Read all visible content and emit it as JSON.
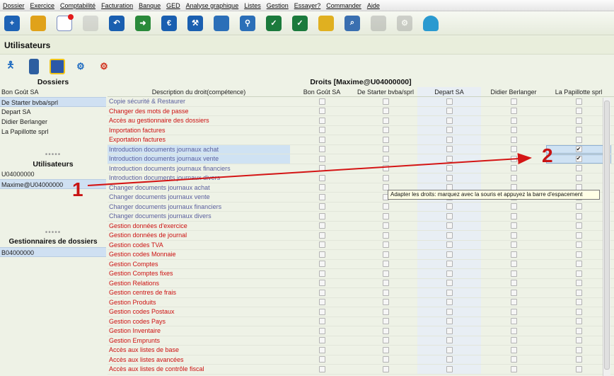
{
  "menu": [
    "Dossier",
    "Exercice",
    "Comptabilité",
    "Facturation",
    "Banque",
    "GED",
    "Analyse graphique",
    "Listes",
    "Gestion",
    "Essayer?",
    "Commander",
    "Aide"
  ],
  "toolbar_icons": [
    "user-add-icon",
    "notes-icon",
    "mail-icon",
    "handshake-icon",
    "book-undo-icon",
    "book-forward-icon",
    "coin-book-icon",
    "book-tools-icon",
    "document-copy-icon",
    "link-icon",
    "film-check-icon",
    "grid-check-icon",
    "map-icon",
    "search-icon",
    "chart-icon",
    "settings-icon",
    "gauge-icon"
  ],
  "page_title": "Utilisateurs",
  "actions": [
    "user-icon",
    "delete-icon",
    "save-icon",
    "settings-user-icon",
    "remove-user-icon"
  ],
  "left": {
    "dossiers_title": "Dossiers",
    "dossiers": [
      "Bon Goût SA",
      "De Starter bvba/sprl",
      "Depart SA",
      "Didier Berlanger",
      "La Papillotte sprl"
    ],
    "utilisateurs_title": "Utilisateurs",
    "utilisateurs": [
      "U04000000",
      "Maxime@U04000000"
    ],
    "gestionnaires_title": "Gestionnaires de dossiers",
    "gestionnaires": [
      "B04000000"
    ]
  },
  "grid": {
    "title": "Droits [Maxime@U04000000]",
    "headers": [
      "Description du droit(compétence)",
      "Bon Goût SA",
      "De Starter bvba/sprl",
      "Depart SA",
      "Didier Berlanger",
      "La Papillotte sprl"
    ],
    "rows": [
      {
        "label": "Copie sécurité & Restaurer",
        "color": "blue",
        "checked": [
          false,
          false,
          false,
          false,
          false
        ]
      },
      {
        "label": "Changer des mots de passe",
        "color": "red",
        "checked": [
          false,
          false,
          false,
          false,
          false
        ]
      },
      {
        "label": "Accès au gestionnaire des dossiers",
        "color": "red",
        "checked": [
          false,
          false,
          false,
          false,
          false
        ]
      },
      {
        "label": "Importation factures",
        "color": "red",
        "checked": [
          false,
          false,
          false,
          false,
          false
        ]
      },
      {
        "label": "Exportation factures",
        "color": "red",
        "checked": [
          false,
          false,
          false,
          false,
          false
        ]
      },
      {
        "label": "Introduction documents journaux achat",
        "color": "blue",
        "checked": [
          false,
          false,
          false,
          false,
          true
        ],
        "highlight": true
      },
      {
        "label": "Introduction documents journaux vente",
        "color": "blue",
        "checked": [
          false,
          false,
          false,
          false,
          true
        ],
        "highlight": true
      },
      {
        "label": "Introduction documents journaux financiers",
        "color": "blue",
        "checked": [
          false,
          false,
          false,
          false,
          false
        ]
      },
      {
        "label": "Introduction documents journaux divers",
        "color": "blue",
        "checked": [
          false,
          false,
          false,
          false,
          false
        ]
      },
      {
        "label": "Changer documents journaux achat",
        "color": "blue",
        "checked": [
          false,
          false,
          false,
          false,
          false
        ]
      },
      {
        "label": "Changer documents journaux vente",
        "color": "blue",
        "checked": [
          false,
          false,
          false,
          false,
          false
        ]
      },
      {
        "label": "Changer documents journaux financiers",
        "color": "blue",
        "checked": [
          false,
          false,
          false,
          false,
          false
        ]
      },
      {
        "label": "Changer documents journaux divers",
        "color": "blue",
        "checked": [
          false,
          false,
          false,
          false,
          false
        ]
      },
      {
        "label": "Gestion données d'exercice",
        "color": "red",
        "checked": [
          false,
          false,
          false,
          false,
          false
        ]
      },
      {
        "label": "Gestion données de journal",
        "color": "red",
        "checked": [
          false,
          false,
          false,
          false,
          false
        ]
      },
      {
        "label": "Gestion codes TVA",
        "color": "red",
        "checked": [
          false,
          false,
          false,
          false,
          false
        ]
      },
      {
        "label": "Gestion codes Monnaie",
        "color": "red",
        "checked": [
          false,
          false,
          false,
          false,
          false
        ]
      },
      {
        "label": "Gestion Comptes",
        "color": "red",
        "checked": [
          false,
          false,
          false,
          false,
          false
        ]
      },
      {
        "label": "Gestion Comptes fixes",
        "color": "red",
        "checked": [
          false,
          false,
          false,
          false,
          false
        ]
      },
      {
        "label": "Gestion Relations",
        "color": "red",
        "checked": [
          false,
          false,
          false,
          false,
          false
        ]
      },
      {
        "label": "Gestion centres de frais",
        "color": "red",
        "checked": [
          false,
          false,
          false,
          false,
          false
        ]
      },
      {
        "label": "Gestion Produits",
        "color": "red",
        "checked": [
          false,
          false,
          false,
          false,
          false
        ]
      },
      {
        "label": "Gestion codes Postaux",
        "color": "red",
        "checked": [
          false,
          false,
          false,
          false,
          false
        ]
      },
      {
        "label": "Gestion codes Pays",
        "color": "red",
        "checked": [
          false,
          false,
          false,
          false,
          false
        ]
      },
      {
        "label": "Gestion Inventaire",
        "color": "red",
        "checked": [
          false,
          false,
          false,
          false,
          false
        ]
      },
      {
        "label": "Gestion Emprunts",
        "color": "red",
        "checked": [
          false,
          false,
          false,
          false,
          false
        ]
      },
      {
        "label": "Accès aux listes de base",
        "color": "red",
        "checked": [
          false,
          false,
          false,
          false,
          false
        ]
      },
      {
        "label": "Accès aux listes avancées",
        "color": "red",
        "checked": [
          false,
          false,
          false,
          false,
          false
        ]
      },
      {
        "label": "Accès aux listes de contrôle fiscal",
        "color": "red",
        "checked": [
          false,
          false,
          false,
          false,
          false
        ]
      }
    ]
  },
  "tooltip": "Adapter les droits: marquez avec la souris et appuyez la barre d'espacement",
  "annotations": {
    "one": "1",
    "two": "2"
  },
  "colors": {
    "red": "#cc1010",
    "blue": "#5a5f9e",
    "highlight": "#cfe2f3",
    "arrow": "#d41515"
  }
}
